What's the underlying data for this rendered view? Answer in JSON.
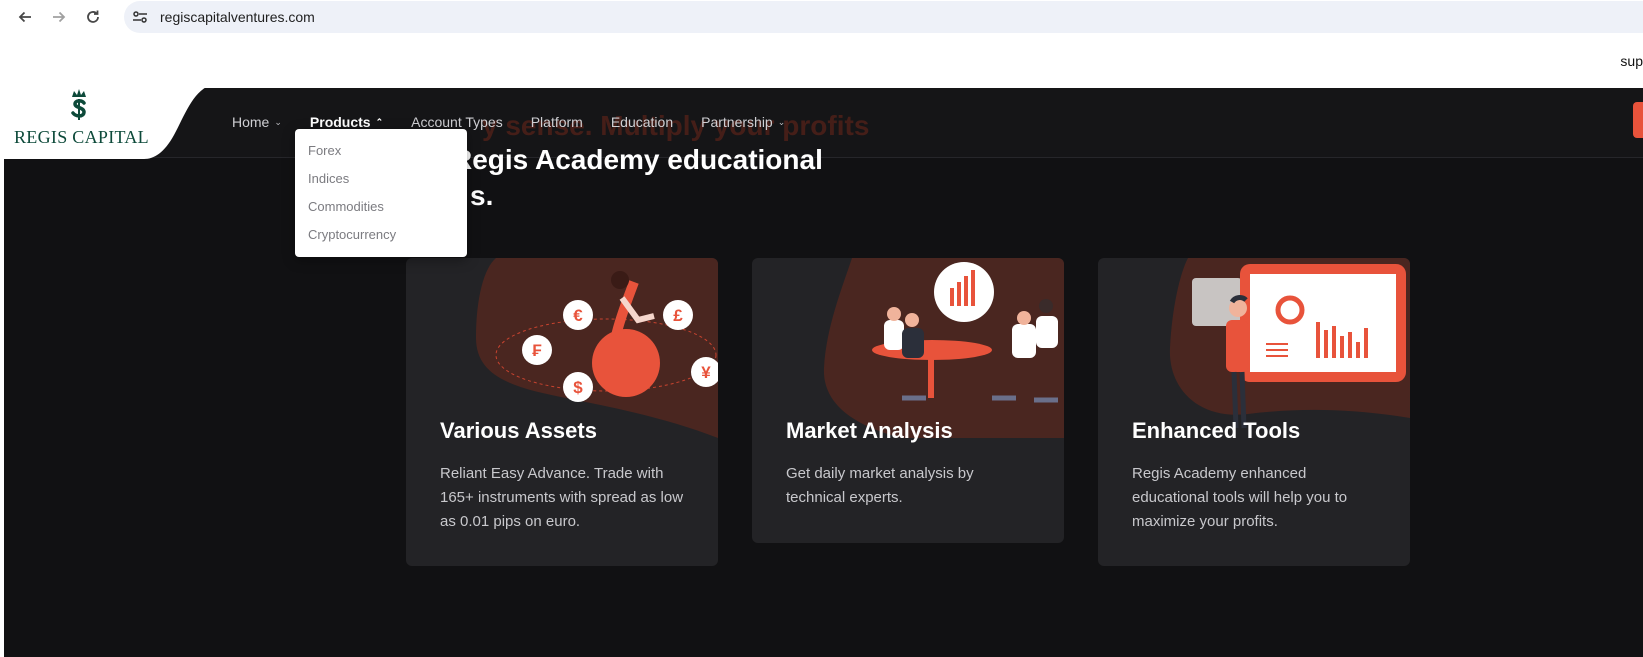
{
  "browser": {
    "back_icon": "arrow-left-icon",
    "forward_icon": "arrow-right-icon",
    "reload_icon": "reload-icon",
    "site_info_icon": "tune-icon",
    "url": "regiscapitalventures.com"
  },
  "topstrip": {
    "support_text": "sup"
  },
  "logo": {
    "text": "REGIS CAPITAL",
    "mark_icon": "crowned-dollar-icon",
    "color": "#0d4a3a"
  },
  "nav": {
    "items": [
      {
        "label": "Home",
        "has_caret": true
      },
      {
        "label": "Products",
        "has_caret": true,
        "active": true
      },
      {
        "label": "Account Types"
      },
      {
        "label": "Platform"
      },
      {
        "label": "Education"
      },
      {
        "label": "Partnership",
        "has_caret": true
      }
    ],
    "caret_down": "⌄",
    "caret_up": "⌃"
  },
  "products_dropdown": {
    "items": [
      "Forex",
      "Indices",
      "Commodities",
      "Cryptocurrency"
    ]
  },
  "hero": {
    "ghost_text": "y sense. Multiply your profits",
    "title_line1": "Regis Academy educational",
    "title_line2": "s."
  },
  "cards": [
    {
      "title": "Various Assets",
      "text": "Reliant Easy Advance. Trade with 165+ instruments with spread as low as 0.01 pips on euro.",
      "illustration": "currency-symbols-illustration"
    },
    {
      "title": "Market Analysis",
      "text": "Get daily market analysis by technical experts.",
      "illustration": "team-meeting-illustration"
    },
    {
      "title": "Enhanced Tools",
      "text": "Regis Academy enhanced educational tools will help you to maximize your profits.",
      "illustration": "presentation-board-illustration"
    }
  ],
  "colors": {
    "accent": "#e8533b",
    "page_bg": "#111113",
    "card_bg": "#232326",
    "blob": "#4a2620"
  }
}
